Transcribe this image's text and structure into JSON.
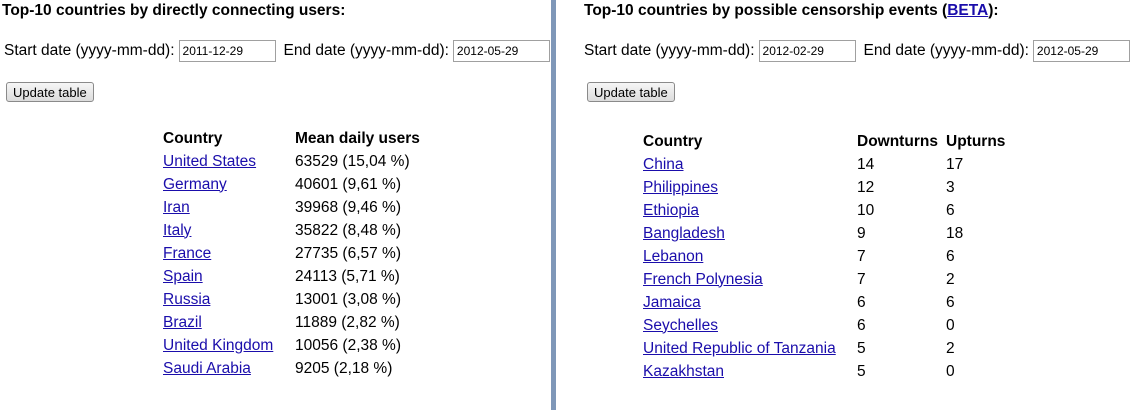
{
  "left": {
    "title": "Top-10 countries by directly connecting users:",
    "start_label": "Start date (yyyy-mm-dd):",
    "start_value": "2011-12-29",
    "end_label": "End date (yyyy-mm-dd):",
    "end_value": "2012-05-29",
    "button_label": "Update table",
    "headers": [
      "Country",
      "Mean daily users"
    ],
    "rows": [
      {
        "country": "United States",
        "users": "63529 (15,04 %)"
      },
      {
        "country": "Germany",
        "users": "40601 (9,61 %)"
      },
      {
        "country": "Iran",
        "users": "39968 (9,46 %)"
      },
      {
        "country": "Italy",
        "users": "35822 (8,48 %)"
      },
      {
        "country": "France",
        "users": "27735 (6,57 %)"
      },
      {
        "country": "Spain",
        "users": "24113 (5,71 %)"
      },
      {
        "country": "Russia",
        "users": "13001 (3,08 %)"
      },
      {
        "country": "Brazil",
        "users": "11889 (2,82 %)"
      },
      {
        "country": "United Kingdom",
        "users": "10056 (2,38 %)"
      },
      {
        "country": "Saudi Arabia",
        "users": "9205 (2,18 %)"
      }
    ]
  },
  "right": {
    "title_prefix": "Top-10 countries by possible censorship events (",
    "title_link": "BETA",
    "title_suffix": "):",
    "start_label": "Start date (yyyy-mm-dd):",
    "start_value": "2012-02-29",
    "end_label": "End date (yyyy-mm-dd):",
    "end_value": "2012-05-29",
    "button_label": "Update table",
    "headers": [
      "Country",
      "Downturns",
      "Upturns"
    ],
    "rows": [
      {
        "country": "China",
        "downturns": "14",
        "upturns": "17"
      },
      {
        "country": "Philippines",
        "downturns": "12",
        "upturns": "3"
      },
      {
        "country": "Ethiopia",
        "downturns": "10",
        "upturns": "6"
      },
      {
        "country": "Bangladesh",
        "downturns": "9",
        "upturns": "18"
      },
      {
        "country": "Lebanon",
        "downturns": "7",
        "upturns": "6"
      },
      {
        "country": "French Polynesia",
        "downturns": "7",
        "upturns": "2"
      },
      {
        "country": "Jamaica",
        "downturns": "6",
        "upturns": "6"
      },
      {
        "country": "Seychelles",
        "downturns": "6",
        "upturns": "0"
      },
      {
        "country": "United Republic of Tanzania",
        "downturns": "5",
        "upturns": "2"
      },
      {
        "country": "Kazakhstan",
        "downturns": "5",
        "upturns": "0"
      }
    ]
  },
  "colors": {
    "link": "#1a0dab",
    "divider": "#7f97b8"
  }
}
